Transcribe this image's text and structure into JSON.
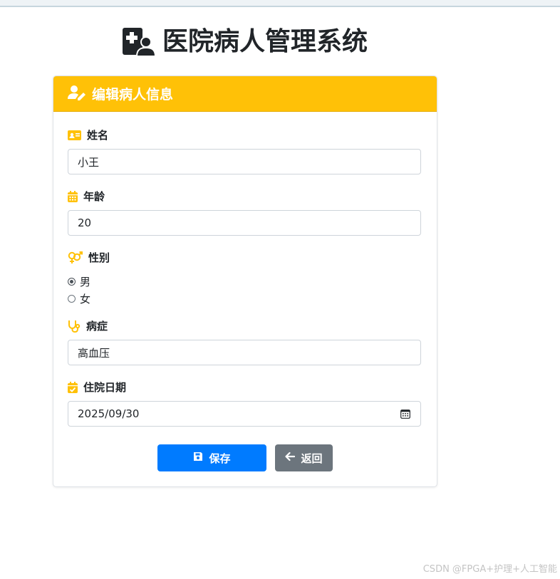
{
  "app": {
    "title": "医院病人管理系统"
  },
  "card": {
    "header_title": "编辑病人信息"
  },
  "form": {
    "name": {
      "label": "姓名",
      "value": "小王"
    },
    "age": {
      "label": "年龄",
      "value": "20"
    },
    "gender": {
      "label": "性别",
      "options": [
        {
          "label": "男",
          "checked": true
        },
        {
          "label": "女",
          "checked": false
        }
      ]
    },
    "disease": {
      "label": "病症",
      "value": "高血压"
    },
    "admission_date": {
      "label": "住院日期",
      "value": "2025/09/30"
    }
  },
  "buttons": {
    "save": "保存",
    "back": "返回"
  },
  "watermark": "CSDN @FPGA+护理+人工智能",
  "colors": {
    "header_bg": "#ffc107",
    "label_icon": "#ffc107",
    "primary": "#007bff",
    "secondary": "#6c757d"
  },
  "icons": {
    "title": "hospital-user-icon",
    "header": "user-edit-icon",
    "name": "id-card-icon",
    "age": "calendar-icon",
    "gender": "venus-mars-icon",
    "disease": "stethoscope-icon",
    "admission_date": "calendar-check-icon",
    "date_picker": "calendar-picker-icon",
    "save": "save-icon",
    "back": "arrow-left-icon"
  }
}
